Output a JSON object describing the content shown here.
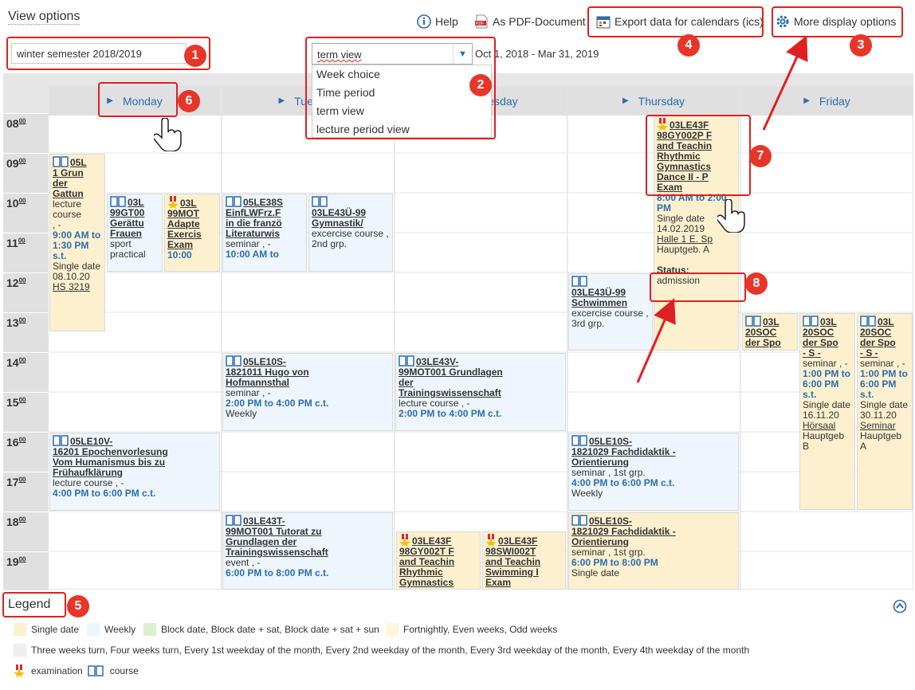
{
  "header": {
    "title": "View options",
    "help": "Help",
    "pdf": "As PDF-Document",
    "export": "Export data for calendars (ics)",
    "more": "More display options"
  },
  "semester": "winter semester 2018/2019",
  "view_select": {
    "value": "term view",
    "options": [
      "Week choice",
      "Time period",
      "term view",
      "lecture period view"
    ]
  },
  "date_range": "Oct 1, 2018 - Mar 31, 2019",
  "days": [
    "Monday",
    "Tuesday",
    "Wednesday",
    "Thursday",
    "Friday"
  ],
  "hours": [
    "08",
    "09",
    "10",
    "11",
    "12",
    "13",
    "14",
    "15",
    "16",
    "17",
    "18",
    "19"
  ],
  "hours_sup": "00",
  "badges": [
    "1",
    "2",
    "3",
    "4",
    "5",
    "6",
    "7",
    "8"
  ],
  "events": [
    {
      "code": "05L",
      "lines": [
        "1 Grun",
        "der",
        "Gattun"
      ],
      "type": "lecture course",
      "extra": ", -",
      "time": "9:00 AM to 1:30 PM s.t.",
      "info": "Single date 08.10.20",
      "room": "HS 3219"
    },
    {
      "code": "03L",
      "lines": [
        "99GT00",
        "Gerättu",
        "Frauen"
      ],
      "type": "sport practical"
    },
    {
      "code": "03L",
      "lines": [
        "99MOT",
        "Adapte",
        "Exercis",
        "Exam"
      ],
      "time": "10:00"
    },
    {
      "code": "05LE38S",
      "lines": [
        "EinfLWFrz.F",
        "in die franzö",
        "Literaturwis"
      ],
      "type": "seminar , -",
      "time": "10:00 AM to"
    },
    {
      "code": "03LE43Ü-99",
      "lines": [
        "Gymnastik/"
      ],
      "type": "excercise course , 2nd grp."
    },
    {
      "code": "03LE43F",
      "lines": [
        "98GY002P F",
        "and Teachin",
        "Rhythmic",
        "Gymnastics",
        "Dance II - P",
        "Exam"
      ],
      "time": "8:00 AM to 2:00 PM",
      "info": "Single date 14.02.2019",
      "room": "Halle 1 E. Sp",
      "room2": "Hauptgeb. A",
      "status_label": "Status:",
      "status": "admission"
    },
    {
      "code": "03LE43Ü-99",
      "lines": [
        "Schwimmen"
      ],
      "type": "excercise course , 3rd grp."
    },
    {
      "code": "03L",
      "lines": [
        "20SOC",
        "der Spo"
      ]
    },
    {
      "code": "03L",
      "lines": [
        "20SOC",
        "der Spo",
        "- S -"
      ],
      "type": "seminar , -",
      "time": "1:00 PM to 6:00 PM s.t.",
      "info": "Single date 16.11.20",
      "room": "Hörsaal",
      "room2": "Hauptgeb B"
    },
    {
      "code": "03L",
      "lines": [
        "20SOC",
        "der Spo",
        "- S -"
      ],
      "type": "seminar , -",
      "time": "1:00 PM to 6:00 PM s.t.",
      "info": "Single date 30.11.20",
      "room": "Seminar",
      "room2": "Hauptgeb A"
    },
    {
      "code": "05LE10S-",
      "lines": [
        "1821011 Hugo von",
        "Hofmannsthal"
      ],
      "type": "seminar , -",
      "time": "2:00 PM to 4:00 PM c.t.",
      "info": "Weekly"
    },
    {
      "code": "03LE43V-",
      "lines": [
        "99MOT001 Grundlagen",
        "der",
        "Trainingswissenschaft"
      ],
      "type": "lecture course , -",
      "time": "2:00 PM to 4:00 PM c.t."
    },
    {
      "code": "05LE10V-",
      "lines": [
        "16201 Epochenvorlesung",
        "Vom Humanismus bis zu",
        "Frühaufklärung"
      ],
      "type": "lecture course , -",
      "time": "4:00 PM to 6:00 PM c.t."
    },
    {
      "code": "05LE10S-",
      "lines": [
        "1821029 Fachdidaktik -",
        "Orientierung"
      ],
      "type": "seminar , 1st grp.",
      "time": "4:00 PM to 6:00 PM c.t.",
      "info": "Weekly"
    },
    {
      "code": "03LE43T-",
      "lines": [
        "99MOT001 Tutorat zu",
        "Grundlagen der",
        "Trainingswissenschaft"
      ],
      "type": "event , -",
      "time": "6:00 PM to 8:00 PM c.t."
    },
    {
      "code": "03LE43F",
      "lines": [
        "98GY002T F",
        "and Teachin",
        "Rhythmic",
        "Gymnastics"
      ]
    },
    {
      "code": "03LE43F",
      "lines": [
        "98SWI002T",
        "and Teachin",
        "Swimming I",
        "Exam"
      ]
    },
    {
      "code": "05LE10S-",
      "lines": [
        "1821029 Fachdidaktik -",
        "Orientierung"
      ],
      "type": "seminar , 1st grp.",
      "time": "6:00 PM to 8:00 PM",
      "info": "Single date"
    }
  ],
  "legend": {
    "title": "Legend",
    "items": [
      {
        "label": "Single date",
        "color": "#fdf0cf"
      },
      {
        "label": "Weekly",
        "color": "#eef5fc"
      },
      {
        "label": "Block date, Block date + sat, Block date + sat + sun",
        "color": "#dfeed2"
      },
      {
        "label": "Fortnightly, Even weeks, Odd weeks",
        "color": "#fdf7dc"
      },
      {
        "label": "Three weeks turn, Four weeks turn, Every 1st weekday of the month, Every 2nd weekday of the month, Every 3rd weekday of the month, Every 4th weekday of the month",
        "color": "#eeeeee"
      }
    ],
    "exam": "examination",
    "course": "course"
  },
  "colors": {
    "accent": "#2a6db3",
    "annotation": "#e02020",
    "single": "#fdf0cf",
    "weekly": "#eef5fc"
  }
}
